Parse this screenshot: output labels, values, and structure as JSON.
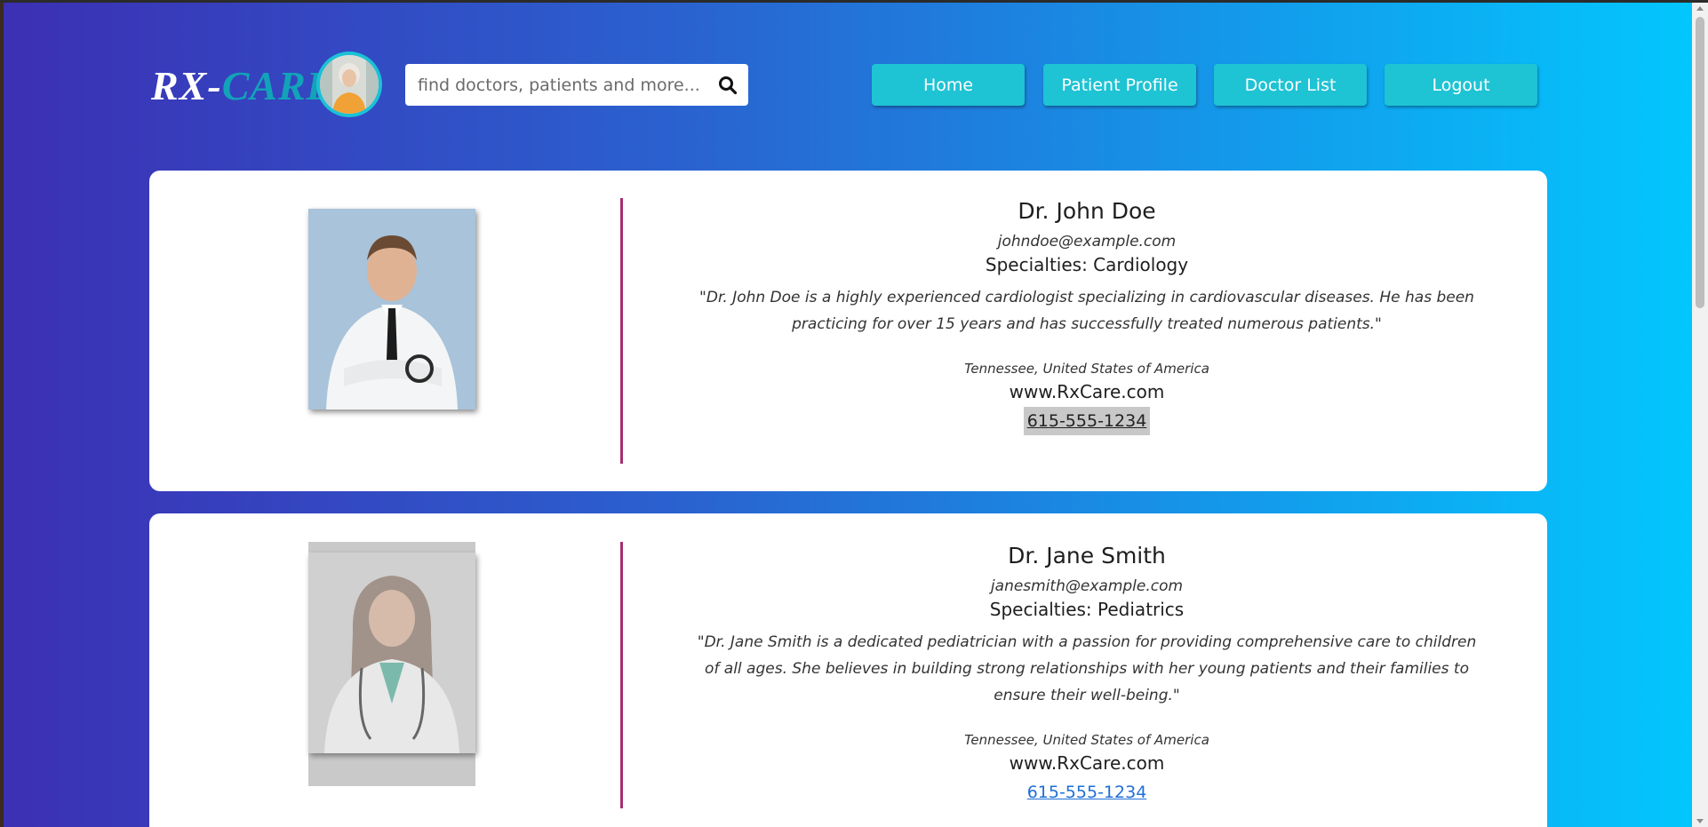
{
  "header": {
    "logo_rx": "RX-",
    "logo_care": "CARE",
    "search_placeholder": "find doctors, patients and more...",
    "nav": [
      {
        "label": "Home"
      },
      {
        "label": "Patient Profile"
      },
      {
        "label": "Doctor List"
      },
      {
        "label": "Logout"
      }
    ]
  },
  "doctors": [
    {
      "name": "Dr. John Doe",
      "email": "johndoe@example.com",
      "specialties": "Specialties: Cardiology",
      "bio": "\"Dr. John Doe is a highly experienced cardiologist specializing in cardiovascular diseases. He has been practicing for over 15 years and has successfully treated numerous patients.\"",
      "location": "Tennessee, United States of America",
      "website": "www.RxCare.com",
      "phone": "615-555-1234"
    },
    {
      "name": "Dr. Jane Smith",
      "email": "janesmith@example.com",
      "specialties": "Specialties: Pediatrics",
      "bio": "\"Dr. Jane Smith is a dedicated pediatrician with a passion for providing comprehensive care to children of all ages. She believes in building strong relationships with her young patients and their families to ensure their well-being.\"",
      "location": "Tennessee, United States of America",
      "website": "www.RxCare.com",
      "phone": "615-555-1234"
    }
  ],
  "colors": {
    "accent_teal": "#1ec3d4",
    "divider": "#a5306e",
    "link": "#1f6fd6"
  }
}
